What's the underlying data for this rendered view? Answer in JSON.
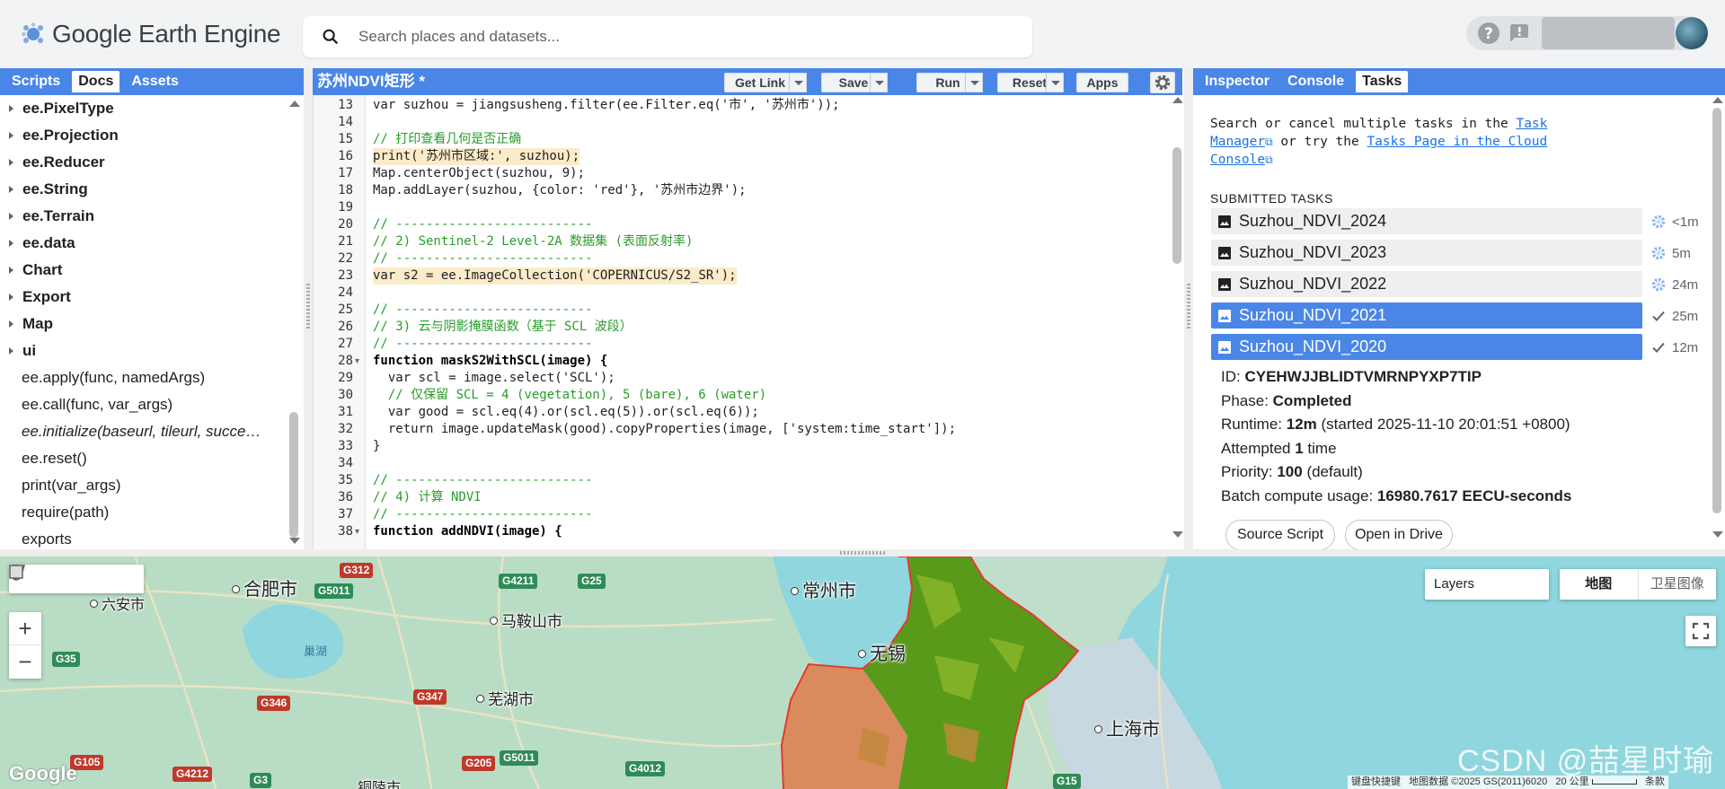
{
  "header": {
    "logo_text": "Google Earth Engine",
    "search_placeholder": "Search places and datasets..."
  },
  "left_panel": {
    "tabs": [
      "Scripts",
      "Docs",
      "Assets"
    ],
    "active_tab": "Docs",
    "namespaces": [
      "ee.PixelType",
      "ee.Projection",
      "ee.Reducer",
      "ee.String",
      "ee.Terrain",
      "ee.data",
      "Chart",
      "Export",
      "Map",
      "ui"
    ],
    "functions": [
      "ee.apply(func, namedArgs)",
      "ee.call(func, var_args)",
      "ee.initialize(baseurl, tileurl, succe…",
      "ee.reset()",
      "print(var_args)",
      "require(path)",
      "exports"
    ]
  },
  "editor": {
    "script_title": "苏州NDVI矩形 *",
    "buttons": {
      "get_link": "Get Link",
      "save": "Save",
      "run": "Run",
      "reset": "Reset",
      "apps": "Apps"
    },
    "line_numbers": [
      "13",
      "14",
      "15",
      "16",
      "17",
      "18",
      "19",
      "20",
      "21",
      "22",
      "23",
      "24",
      "25",
      "26",
      "27",
      "28",
      "29",
      "30",
      "31",
      "32",
      "33",
      "34",
      "35",
      "36",
      "37",
      "38"
    ],
    "code_lines": [
      "var suzhou = jiangsusheng.filter(ee.Filter.eq('市', '苏州市'));",
      "",
      "// 打印查看几何是否正确",
      "print('苏州市区域:', suzhou);",
      "Map.centerObject(suzhou, 9);",
      "Map.addLayer(suzhou, {color: 'red'}, '苏州市边界');",
      "",
      "// --------------------------",
      "// 2) Sentinel-2 Level-2A 数据集 (表面反射率)",
      "// --------------------------",
      "var s2 = ee.ImageCollection('COPERNICUS/S2_SR');",
      "",
      "// --------------------------",
      "// 3) 云与阴影掩膜函数（基于 SCL 波段）",
      "// --------------------------",
      "function maskS2WithSCL(image) {",
      "  var scl = image.select('SCL');",
      "  // 仅保留 SCL = 4 (vegetation), 5 (bare), 6 (water)",
      "  var good = scl.eq(4).or(scl.eq(5)).or(scl.eq(6));",
      "  return image.updateMask(good).copyProperties(image, ['system:time_start']);",
      "}",
      "",
      "// --------------------------",
      "// 4) 计算 NDVI",
      "// --------------------------",
      "function addNDVI(image) {"
    ]
  },
  "right_panel": {
    "tabs": [
      "Inspector",
      "Console",
      "Tasks"
    ],
    "active_tab": "Tasks",
    "help_text_1": "Search or cancel multiple tasks in the ",
    "help_link_1": "Task Manager",
    "help_text_2": " or try the ",
    "help_link_2": "Tasks Page in the Cloud Console",
    "submitted_label": "SUBMITTED TASKS",
    "tasks": [
      {
        "name": "Suzhou_NDVI_2024",
        "time": "<1m",
        "state": "running"
      },
      {
        "name": "Suzhou_NDVI_2023",
        "time": "5m",
        "state": "running"
      },
      {
        "name": "Suzhou_NDVI_2022",
        "time": "24m",
        "state": "running"
      },
      {
        "name": "Suzhou_NDVI_2021",
        "time": "25m",
        "state": "completed"
      },
      {
        "name": "Suzhou_NDVI_2020",
        "time": "12m",
        "state": "completed"
      }
    ],
    "details": {
      "id_label": "ID: ",
      "id_value": "CYEHWJJBLIDTVMRNPYXP7TIP",
      "phase_label": "Phase: ",
      "phase_value": "Completed",
      "runtime_label": "Runtime: ",
      "runtime_value": "12m",
      "runtime_rest": " (started 2025-11-10 20:01:51 +0800)",
      "attempted_label": "Attempted ",
      "attempted_value": "1",
      "attempted_rest": " time",
      "priority_label": "Priority: ",
      "priority_value": "100",
      "priority_rest": " (default)",
      "batch_label": "Batch compute usage: ",
      "batch_value": "16980.7617 EECU-seconds"
    },
    "source_script_btn": "Source Script",
    "open_drive_btn": "Open in Drive"
  },
  "map": {
    "layers_label": "Layers",
    "map_type": [
      "地图",
      "卫星图像"
    ],
    "cities": [
      "合肥市",
      "六安市",
      "马鞍山市",
      "芜湖市",
      "常州市",
      "无锡",
      "上海市",
      "铜陵市"
    ],
    "lake": "巢湖",
    "roads": [
      "G312",
      "G5011",
      "G4211",
      "G25",
      "G35",
      "G346",
      "G347",
      "G105",
      "G4212",
      "G3",
      "G205",
      "G5011",
      "G4012",
      "G15"
    ],
    "google_logo": "Google",
    "attribution": [
      "键盘快捷键",
      "地图数据 ©2025 GS(2011)6020",
      "20 公里",
      "条款"
    ],
    "watermark": "CSDN @喆星时瑜",
    "colors": {
      "water": "#8fd6de",
      "land": "#b8dcc6",
      "boundary": "#e53935",
      "ndvi_green": "#5a9a1a",
      "ndvi_orange": "#d98b5e"
    }
  }
}
